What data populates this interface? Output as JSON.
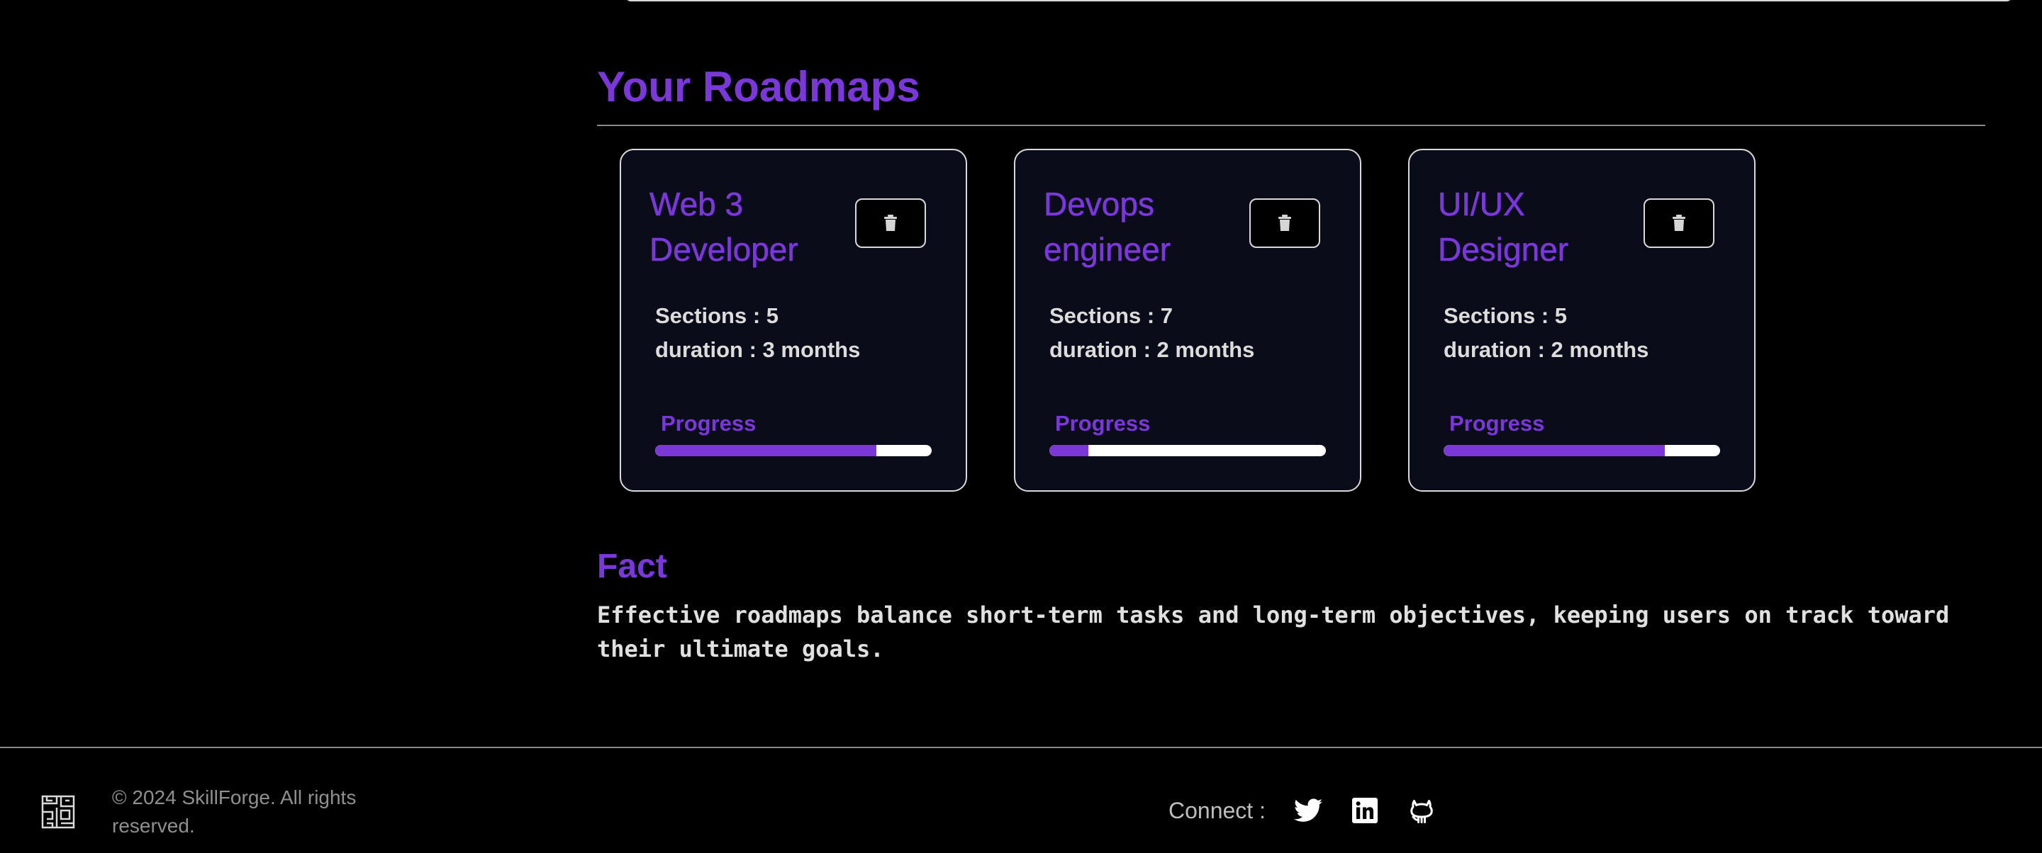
{
  "roadmaps": {
    "title": "Your Roadmaps",
    "cards": [
      {
        "title_line1": "Web 3",
        "title_line2": "Developer",
        "sections": "Sections : 5",
        "duration": "duration : 3 months",
        "progress_label": "Progress",
        "progress": 0.8,
        "delete_icon": "trash-icon"
      },
      {
        "title_line1": "Devops",
        "title_line2": "engineer",
        "sections": "Sections : 7",
        "duration": "duration : 2 months",
        "progress_label": "Progress",
        "progress": 0.14,
        "delete_icon": "trash-icon"
      },
      {
        "title_line1": "UI/UX",
        "title_line2": "Designer",
        "sections": "Sections : 5",
        "duration": "duration : 2 months",
        "progress_label": "Progress",
        "progress": 0.8,
        "delete_icon": "trash-icon"
      }
    ]
  },
  "fact": {
    "title": "Fact",
    "text": "Effective roadmaps balance short-term tasks and long-term objectives, keeping users on track toward their ultimate goals."
  },
  "footer": {
    "logo_icon": "skillforge-logo-icon",
    "copyright": "© 2024 SkillForge. All rights reserved.",
    "connect_label": "Connect :",
    "social_icons": [
      "twitter-icon",
      "linkedin-icon",
      "github-icon"
    ]
  },
  "colors": {
    "accent": "#7a38d8",
    "background": "#000000",
    "card_background": "#0b0c1a",
    "border": "#d9d9d9",
    "progress_track": "#ffffff"
  }
}
